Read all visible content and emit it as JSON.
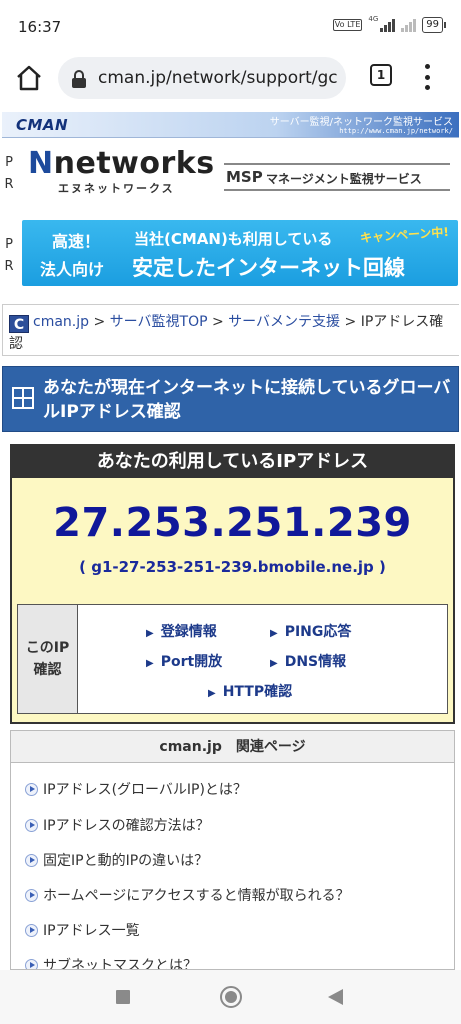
{
  "status": {
    "time": "16:37",
    "volte": "Vo LTE",
    "network": "4G",
    "battery": "99"
  },
  "browser": {
    "url": "cman.jp/network/support/gc",
    "tab_count": "1"
  },
  "header": {
    "logo": "CMAN",
    "service": "サーバー監視/ネットワーク監視サービス",
    "url": "http://www.cman.jp/network/"
  },
  "pr": {
    "p": "P",
    "r": "R"
  },
  "nnetworks": {
    "logo_first": "N",
    "logo_rest": "networks",
    "kana": "エヌネットワークス"
  },
  "msp": {
    "abbr": "MSP",
    "text": "マネージメント監視サービス"
  },
  "campaign": {
    "left1": "高速！",
    "left2": "法人向け",
    "right1": "当社(CMAN)も利用している",
    "right2": "安定したインターネット回線",
    "badge": "キャンペーン中!"
  },
  "breadcrumb": {
    "icon": "C",
    "items": [
      "cman.jp",
      "サーバ監視TOP",
      "サーバメンテ支援"
    ],
    "separator": " > ",
    "current": "IPアドレス確認"
  },
  "title": "あなたが現在インターネットに接続しているグローバルIPアドレス確認",
  "ip": {
    "heading": "あなたの利用しているIPアドレス",
    "address": "27.253.251.239",
    "host": "( g1-27-253-251-239.bmobile.ne.jp )",
    "check_label": "このIP確認",
    "links": [
      "登録情報",
      "PING応答",
      "Port開放",
      "DNS情報",
      "HTTP確認"
    ]
  },
  "related": {
    "heading": "cman.jp　関連ページ",
    "items": [
      "IPアドレス(グローバルIP)とは？",
      "IPアドレスの確認方法は？",
      "固定IPと動的IPの違いは？",
      "ホームページにアクセスすると情報が取られる？",
      "IPアドレス一覧",
      "サブネットマスクとは？"
    ]
  },
  "colors": {
    "ip_blue": "#10189a",
    "title_bg": "#2f63a8",
    "ip_bg": "#fdf8c3",
    "campaign_bg": "#1b9ee0"
  }
}
